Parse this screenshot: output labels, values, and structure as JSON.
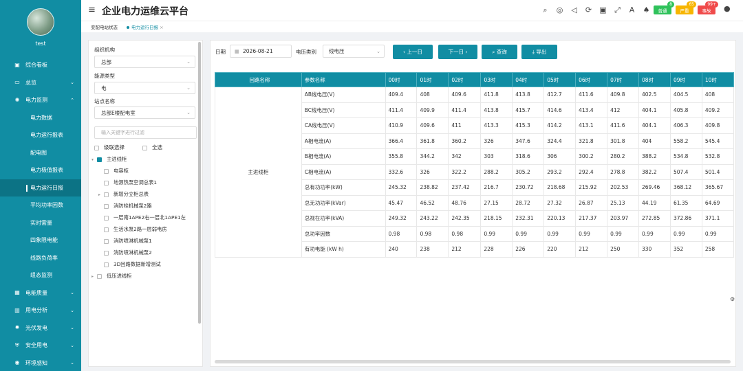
{
  "user": {
    "name": "test"
  },
  "app": {
    "title": "企业电力运维云平台"
  },
  "sidebar": {
    "items": [
      {
        "label": "综合看板",
        "icon": "monitor-icon",
        "level": 1
      },
      {
        "label": "总览",
        "icon": "screen-icon",
        "level": 1,
        "chevron": "⌄"
      },
      {
        "label": "电力监测",
        "icon": "gear-icon",
        "level": 1,
        "chevron": "⌃"
      },
      {
        "label": "电力数据",
        "level": 2
      },
      {
        "label": "电力运行报表",
        "level": 2
      },
      {
        "label": "配电图",
        "level": 2
      },
      {
        "label": "电力极值报表",
        "level": 2
      },
      {
        "label": "电力运行日报",
        "level": 2,
        "active": true
      },
      {
        "label": "平均功率因数",
        "level": 2
      },
      {
        "label": "实时需量",
        "level": 2
      },
      {
        "label": "四象限电能",
        "level": 2
      },
      {
        "label": "线路负荷率",
        "level": 2
      },
      {
        "label": "组态监测",
        "level": 2
      },
      {
        "label": "电能质量",
        "icon": "grid-icon",
        "level": 1,
        "chevron": "⌄"
      },
      {
        "label": "用电分析",
        "icon": "bar-chart-icon",
        "level": 1,
        "chevron": "⌄"
      },
      {
        "label": "光伏发电",
        "icon": "sun-icon",
        "level": 1,
        "chevron": "⌄"
      },
      {
        "label": "安全用电",
        "icon": "shield-icon",
        "level": 1,
        "chevron": "⌄"
      },
      {
        "label": "环境感知",
        "icon": "sensor-icon",
        "level": 1,
        "chevron": "⌄"
      }
    ]
  },
  "header": {
    "badges": [
      {
        "label": "普通",
        "count": "8",
        "color": "#2fc25b"
      },
      {
        "label": "严重",
        "count": "65",
        "color": "#f7b500"
      },
      {
        "label": "事故",
        "count": "99+",
        "color": "#f04b4b"
      }
    ]
  },
  "tabs": [
    {
      "label": "变配电站状态"
    },
    {
      "label": "电力运行日报",
      "close": "×"
    }
  ],
  "filters": {
    "org_label": "组织机构",
    "org_value": "总部",
    "energy_label": "能源类型",
    "energy_value": "电",
    "station_label": "站点名称",
    "station_value": "总部E楼配电室",
    "keyword_placeholder": "输入关键字进行过滤",
    "cascade_label": "级联选择",
    "selectall_label": "全选"
  },
  "tree": [
    {
      "label": "主进线柜",
      "indent": 0,
      "checked": true,
      "arrow": "▾"
    },
    {
      "label": "电容柜",
      "indent": 1
    },
    {
      "label": "地源热泵空调总表1",
      "indent": 1
    },
    {
      "label": "新增分立柜总表",
      "indent": 1,
      "arrow": "▸"
    },
    {
      "label": "消防栓机械泵2路",
      "indent": 1
    },
    {
      "label": "一层南1APE2右一层北1APE1左",
      "indent": 1
    },
    {
      "label": "生活水泵2路一层弱电房",
      "indent": 1
    },
    {
      "label": "消防喷淋机械泵1",
      "indent": 1
    },
    {
      "label": "消防喷淋机械泵2",
      "indent": 1
    },
    {
      "label": "3D回路数据新增测试",
      "indent": 1
    },
    {
      "label": "低压进线柜",
      "indent": 0,
      "arrow": "▸"
    }
  ],
  "toolbar": {
    "date_label": "日期",
    "date_value": "2026-08-21",
    "voltage_label": "电压类别",
    "voltage_value": "线电压",
    "prev_label": "上一日",
    "next_label": "下一日",
    "query_label": "查询",
    "export_label": "导出"
  },
  "table": {
    "headers": [
      "回路名称",
      "参数名称",
      "00时",
      "01时",
      "02时",
      "03时",
      "04时",
      "05时",
      "06时",
      "07时",
      "08时",
      "09时",
      "10时"
    ],
    "circuit": "主进线柜",
    "rows": [
      [
        "AB线电压(V)",
        "409.4",
        "408",
        "409.6",
        "411.8",
        "413.8",
        "412.7",
        "411.6",
        "409.8",
        "402.5",
        "404.5",
        "408"
      ],
      [
        "BC线电压(V)",
        "411.4",
        "409.9",
        "411.4",
        "413.8",
        "415.7",
        "414.6",
        "413.4",
        "412",
        "404.1",
        "405.8",
        "409.2"
      ],
      [
        "CA线电压(V)",
        "410.9",
        "409.6",
        "411",
        "413.3",
        "415.3",
        "414.2",
        "413.1",
        "411.6",
        "404.1",
        "406.3",
        "409.8"
      ],
      [
        "A相电流(A)",
        "366.4",
        "361.8",
        "360.2",
        "326",
        "347.6",
        "324.4",
        "321.8",
        "301.8",
        "404",
        "558.2",
        "545.4"
      ],
      [
        "B相电流(A)",
        "355.8",
        "344.2",
        "342",
        "303",
        "318.6",
        "306",
        "300.2",
        "280.2",
        "388.2",
        "534.8",
        "532.8"
      ],
      [
        "C相电流(A)",
        "332.6",
        "326",
        "322.2",
        "288.2",
        "305.2",
        "293.2",
        "292.4",
        "278.8",
        "382.2",
        "507.4",
        "501.4"
      ],
      [
        "总有功功率(kW)",
        "245.32",
        "238.82",
        "237.42",
        "216.7",
        "230.72",
        "218.68",
        "215.92",
        "202.53",
        "269.46",
        "368.12",
        "365.67"
      ],
      [
        "总无功功率(kVar)",
        "45.47",
        "46.52",
        "48.76",
        "27.15",
        "28.72",
        "27.32",
        "26.87",
        "25.13",
        "44.19",
        "61.35",
        "64.69"
      ],
      [
        "总视在功率(kVA)",
        "249.32",
        "243.22",
        "242.35",
        "218.15",
        "232.31",
        "220.13",
        "217.37",
        "203.97",
        "272.85",
        "372.86",
        "371.1"
      ],
      [
        "总功率因数",
        "0.98",
        "0.98",
        "0.98",
        "0.99",
        "0.99",
        "0.99",
        "0.99",
        "0.99",
        "0.99",
        "0.99",
        "0.99"
      ],
      [
        "有功电能 (kW h)",
        "240",
        "238",
        "212",
        "228",
        "226",
        "220",
        "212",
        "250",
        "330",
        "352",
        "258"
      ]
    ]
  }
}
